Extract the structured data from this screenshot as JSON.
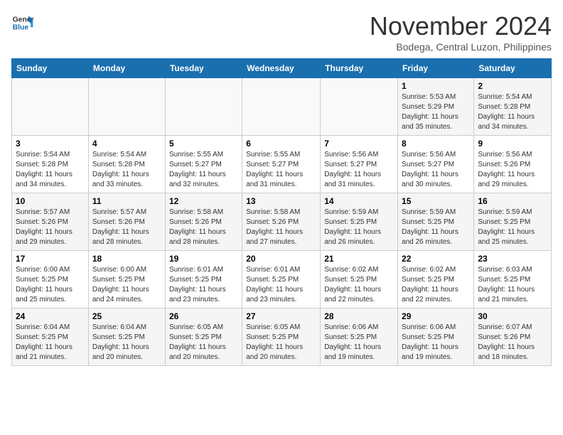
{
  "logo": {
    "line1": "General",
    "line2": "Blue"
  },
  "title": "November 2024",
  "location": "Bodega, Central Luzon, Philippines",
  "weekdays": [
    "Sunday",
    "Monday",
    "Tuesday",
    "Wednesday",
    "Thursday",
    "Friday",
    "Saturday"
  ],
  "weeks": [
    [
      {
        "day": "",
        "info": ""
      },
      {
        "day": "",
        "info": ""
      },
      {
        "day": "",
        "info": ""
      },
      {
        "day": "",
        "info": ""
      },
      {
        "day": "",
        "info": ""
      },
      {
        "day": "1",
        "info": "Sunrise: 5:53 AM\nSunset: 5:29 PM\nDaylight: 11 hours\nand 35 minutes."
      },
      {
        "day": "2",
        "info": "Sunrise: 5:54 AM\nSunset: 5:28 PM\nDaylight: 11 hours\nand 34 minutes."
      }
    ],
    [
      {
        "day": "3",
        "info": "Sunrise: 5:54 AM\nSunset: 5:28 PM\nDaylight: 11 hours\nand 34 minutes."
      },
      {
        "day": "4",
        "info": "Sunrise: 5:54 AM\nSunset: 5:28 PM\nDaylight: 11 hours\nand 33 minutes."
      },
      {
        "day": "5",
        "info": "Sunrise: 5:55 AM\nSunset: 5:27 PM\nDaylight: 11 hours\nand 32 minutes."
      },
      {
        "day": "6",
        "info": "Sunrise: 5:55 AM\nSunset: 5:27 PM\nDaylight: 11 hours\nand 31 minutes."
      },
      {
        "day": "7",
        "info": "Sunrise: 5:56 AM\nSunset: 5:27 PM\nDaylight: 11 hours\nand 31 minutes."
      },
      {
        "day": "8",
        "info": "Sunrise: 5:56 AM\nSunset: 5:27 PM\nDaylight: 11 hours\nand 30 minutes."
      },
      {
        "day": "9",
        "info": "Sunrise: 5:56 AM\nSunset: 5:26 PM\nDaylight: 11 hours\nand 29 minutes."
      }
    ],
    [
      {
        "day": "10",
        "info": "Sunrise: 5:57 AM\nSunset: 5:26 PM\nDaylight: 11 hours\nand 29 minutes."
      },
      {
        "day": "11",
        "info": "Sunrise: 5:57 AM\nSunset: 5:26 PM\nDaylight: 11 hours\nand 28 minutes."
      },
      {
        "day": "12",
        "info": "Sunrise: 5:58 AM\nSunset: 5:26 PM\nDaylight: 11 hours\nand 28 minutes."
      },
      {
        "day": "13",
        "info": "Sunrise: 5:58 AM\nSunset: 5:26 PM\nDaylight: 11 hours\nand 27 minutes."
      },
      {
        "day": "14",
        "info": "Sunrise: 5:59 AM\nSunset: 5:25 PM\nDaylight: 11 hours\nand 26 minutes."
      },
      {
        "day": "15",
        "info": "Sunrise: 5:59 AM\nSunset: 5:25 PM\nDaylight: 11 hours\nand 26 minutes."
      },
      {
        "day": "16",
        "info": "Sunrise: 5:59 AM\nSunset: 5:25 PM\nDaylight: 11 hours\nand 25 minutes."
      }
    ],
    [
      {
        "day": "17",
        "info": "Sunrise: 6:00 AM\nSunset: 5:25 PM\nDaylight: 11 hours\nand 25 minutes."
      },
      {
        "day": "18",
        "info": "Sunrise: 6:00 AM\nSunset: 5:25 PM\nDaylight: 11 hours\nand 24 minutes."
      },
      {
        "day": "19",
        "info": "Sunrise: 6:01 AM\nSunset: 5:25 PM\nDaylight: 11 hours\nand 23 minutes."
      },
      {
        "day": "20",
        "info": "Sunrise: 6:01 AM\nSunset: 5:25 PM\nDaylight: 11 hours\nand 23 minutes."
      },
      {
        "day": "21",
        "info": "Sunrise: 6:02 AM\nSunset: 5:25 PM\nDaylight: 11 hours\nand 22 minutes."
      },
      {
        "day": "22",
        "info": "Sunrise: 6:02 AM\nSunset: 5:25 PM\nDaylight: 11 hours\nand 22 minutes."
      },
      {
        "day": "23",
        "info": "Sunrise: 6:03 AM\nSunset: 5:25 PM\nDaylight: 11 hours\nand 21 minutes."
      }
    ],
    [
      {
        "day": "24",
        "info": "Sunrise: 6:04 AM\nSunset: 5:25 PM\nDaylight: 11 hours\nand 21 minutes."
      },
      {
        "day": "25",
        "info": "Sunrise: 6:04 AM\nSunset: 5:25 PM\nDaylight: 11 hours\nand 20 minutes."
      },
      {
        "day": "26",
        "info": "Sunrise: 6:05 AM\nSunset: 5:25 PM\nDaylight: 11 hours\nand 20 minutes."
      },
      {
        "day": "27",
        "info": "Sunrise: 6:05 AM\nSunset: 5:25 PM\nDaylight: 11 hours\nand 20 minutes."
      },
      {
        "day": "28",
        "info": "Sunrise: 6:06 AM\nSunset: 5:25 PM\nDaylight: 11 hours\nand 19 minutes."
      },
      {
        "day": "29",
        "info": "Sunrise: 6:06 AM\nSunset: 5:25 PM\nDaylight: 11 hours\nand 19 minutes."
      },
      {
        "day": "30",
        "info": "Sunrise: 6:07 AM\nSunset: 5:26 PM\nDaylight: 11 hours\nand 18 minutes."
      }
    ]
  ]
}
